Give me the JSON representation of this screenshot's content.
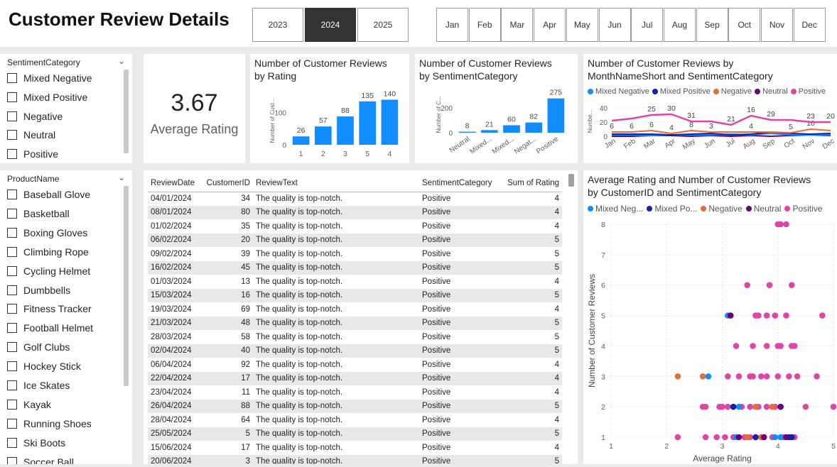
{
  "header": {
    "title": "Customer Review Details",
    "years": [
      {
        "label": "2023",
        "selected": false
      },
      {
        "label": "2024",
        "selected": true
      },
      {
        "label": "2025",
        "selected": false
      }
    ],
    "months": [
      "Jan",
      "Feb",
      "Mar",
      "Apr",
      "May",
      "Jun",
      "Jul",
      "Aug",
      "Sep",
      "Oct",
      "Nov",
      "Dec"
    ]
  },
  "sentiment_slicer": {
    "title": "SentimentCategory",
    "items": [
      "Mixed Negative",
      "Mixed Positive",
      "Negative",
      "Neutral",
      "Positive"
    ]
  },
  "product_slicer": {
    "title": "ProductName",
    "items": [
      "Baseball Glove",
      "Basketball",
      "Boxing Gloves",
      "Climbing Rope",
      "Cycling Helmet",
      "Dumbbells",
      "Fitness Tracker",
      "Football Helmet",
      "Golf Clubs",
      "Hockey Stick",
      "Ice Skates",
      "Kayak",
      "Running Shoes",
      "Ski Boots",
      "Soccer Ball"
    ]
  },
  "kpi": {
    "value": "3.67",
    "label": "Average Rating"
  },
  "colors": {
    "bar": "#118dff",
    "mixed_negative": "#118dff",
    "mixed_positive": "#12239e",
    "negative": "#e66c37",
    "neutral": "#6b007b",
    "positive": "#e044a7"
  },
  "chart_rating": {
    "title_line1": "Number of Customer Reviews",
    "title_line2": "by Rating",
    "ylabel": "Number of Cust...",
    "chart_data": {
      "type": "bar",
      "categories": [
        "1",
        "2",
        "3",
        "5",
        "4"
      ],
      "values": [
        26,
        57,
        88,
        135,
        140
      ],
      "ylim": [
        0,
        150
      ],
      "yticks": [
        "0",
        "100"
      ]
    }
  },
  "chart_sentiment": {
    "title_line1": "Number of Customer Reviews",
    "title_line2": "by SentimentCategory",
    "ylabel": "Number of C...",
    "chart_data": {
      "type": "bar",
      "categories": [
        "Neutral",
        "Mixed...",
        "Mixed...",
        "Negat...",
        "Positive"
      ],
      "values": [
        8,
        21,
        60,
        82,
        275
      ],
      "ylim": [
        0,
        290
      ],
      "yticks": [
        "0",
        "200"
      ]
    }
  },
  "chart_month": {
    "title_line1": "Number of Customer Reviews by",
    "title_line2": "MonthNameShort and SentimentCategory",
    "ylabel": "Numbe...",
    "legend": [
      "Mixed Negative",
      "Mixed Positive",
      "Negative",
      "Neutral",
      "Positive"
    ],
    "yticks": [
      "0",
      "20",
      "40"
    ],
    "chart_data": {
      "type": "line",
      "x": [
        "Jan",
        "Feb",
        "Mar",
        "Apr",
        "May",
        "Jun",
        "Jul",
        "Aug",
        "Sep",
        "Oct",
        "Nov",
        "Dec"
      ],
      "ylim": [
        0,
        42
      ],
      "series": [
        {
          "name": "Positive",
          "values": [
            22,
            25,
            30,
            31,
            21,
            21,
            16,
            29,
            23,
            23,
            20,
            20
          ],
          "labels": [
            "",
            "",
            "25",
            "30",
            "31",
            "",
            "21",
            "16",
            "29",
            "",
            "23",
            "20"
          ]
        },
        {
          "name": "Negative",
          "values": [
            6,
            6,
            8,
            4,
            8,
            6,
            6,
            6,
            6,
            5,
            10,
            8
          ],
          "labels": [
            "6",
            "6",
            "6",
            "4",
            "8",
            "3",
            "",
            "4",
            "",
            "5",
            "10",
            ""
          ]
        },
        {
          "name": "Mixed Positive",
          "values": [
            3,
            3,
            3,
            2,
            3,
            4,
            2,
            3,
            6,
            4,
            3,
            4
          ],
          "labels": []
        },
        {
          "name": "Mixed Negative",
          "values": [
            2,
            2,
            1,
            2,
            2,
            2,
            3,
            2,
            4,
            2,
            2,
            2
          ],
          "labels": []
        },
        {
          "name": "Neutral",
          "values": [
            0,
            0,
            1,
            1,
            0,
            1,
            0,
            1,
            0,
            1,
            2,
            1
          ],
          "labels": []
        }
      ]
    }
  },
  "chart_scatter": {
    "title_line1": "Average Rating and Number of Customer Reviews",
    "title_line2": "by CustomerID and SentimentCategory",
    "legend": [
      "Mixed Neg...",
      "Mixed Po...",
      "Negative",
      "Neutral",
      "Positive"
    ],
    "xlabel": "Average Rating",
    "ylabel": "Number of Customer Reviews",
    "xticks": [
      "1",
      "2",
      "3",
      "4",
      "5"
    ],
    "yticks": [
      "1",
      "2",
      "3",
      "4",
      "5",
      "6",
      "7",
      "8"
    ],
    "chart_data": {
      "type": "scatter",
      "xlim": [
        1,
        5
      ],
      "ylim": [
        1,
        8
      ],
      "series": [
        {
          "name": "Positive",
          "points": [
            [
              4.0,
              8
            ],
            [
              4.05,
              8
            ],
            [
              4.15,
              8
            ],
            [
              3.45,
              6
            ],
            [
              3.85,
              6
            ],
            [
              4.25,
              6
            ],
            [
              3.6,
              5
            ],
            [
              3.65,
              5
            ],
            [
              3.8,
              5
            ],
            [
              3.95,
              5
            ],
            [
              4.15,
              5
            ],
            [
              4.8,
              5
            ],
            [
              3.25,
              4
            ],
            [
              3.55,
              4
            ],
            [
              3.8,
              4
            ],
            [
              4.0,
              4
            ],
            [
              4.05,
              4
            ],
            [
              4.25,
              4
            ],
            [
              4.3,
              4
            ],
            [
              3.1,
              3
            ],
            [
              3.3,
              3
            ],
            [
              3.5,
              3
            ],
            [
              3.55,
              3
            ],
            [
              3.7,
              3
            ],
            [
              3.8,
              3
            ],
            [
              4.0,
              3
            ],
            [
              4.2,
              3
            ],
            [
              4.35,
              3
            ],
            [
              4.7,
              3
            ],
            [
              2.65,
              2
            ],
            [
              2.7,
              2
            ],
            [
              2.95,
              2
            ],
            [
              3.0,
              2
            ],
            [
              3.1,
              2
            ],
            [
              3.2,
              2
            ],
            [
              3.35,
              2
            ],
            [
              3.5,
              2
            ],
            [
              3.65,
              2
            ],
            [
              3.8,
              2
            ],
            [
              3.95,
              2
            ],
            [
              4.05,
              2
            ],
            [
              4.5,
              2
            ],
            [
              5.0,
              2
            ],
            [
              2.2,
              1
            ],
            [
              2.7,
              1
            ],
            [
              2.9,
              1
            ],
            [
              3.05,
              1
            ],
            [
              3.2,
              1
            ],
            [
              3.4,
              1
            ],
            [
              3.5,
              1
            ],
            [
              3.6,
              1
            ],
            [
              3.75,
              1
            ],
            [
              3.9,
              1
            ],
            [
              4.1,
              1
            ],
            [
              4.3,
              1
            ]
          ]
        },
        {
          "name": "Negative",
          "points": [
            [
              2.2,
              3
            ],
            [
              2.65,
              3
            ],
            [
              3.6,
              2
            ],
            [
              3.9,
              2
            ],
            [
              3.45,
              1
            ],
            [
              3.7,
              1
            ]
          ]
        },
        {
          "name": "Mixed Negative",
          "points": [
            [
              3.1,
              5
            ],
            [
              2.75,
              3
            ],
            [
              3.3,
              2
            ],
            [
              3.25,
              1
            ],
            [
              3.95,
              1
            ],
            [
              4.05,
              1
            ]
          ]
        },
        {
          "name": "Mixed Positive",
          "points": [
            [
              3.2,
              2
            ],
            [
              3.6,
              1
            ],
            [
              4.2,
              1
            ],
            [
              4.25,
              1
            ]
          ]
        },
        {
          "name": "Neutral",
          "points": [
            [
              3.15,
              5
            ],
            [
              4.05,
              2
            ],
            [
              3.3,
              1
            ],
            [
              3.75,
              1
            ],
            [
              4.15,
              1
            ]
          ]
        }
      ]
    }
  },
  "table": {
    "columns": [
      "ReviewDate",
      "CustomerID",
      "ReviewText",
      "SentimentCategory",
      "Sum of Rating"
    ],
    "rows": [
      [
        "04/01/2024",
        "34",
        "The quality is top-notch.",
        "Positive",
        "4"
      ],
      [
        "08/01/2024",
        "80",
        "The quality is top-notch.",
        "Positive",
        "4"
      ],
      [
        "01/02/2024",
        "35",
        "The quality is top-notch.",
        "Positive",
        "4"
      ],
      [
        "06/02/2024",
        "20",
        "The quality is top-notch.",
        "Positive",
        "5"
      ],
      [
        "09/02/2024",
        "39",
        "The quality is top-notch.",
        "Positive",
        "5"
      ],
      [
        "16/02/2024",
        "45",
        "The quality is top-notch.",
        "Positive",
        "5"
      ],
      [
        "01/03/2024",
        "13",
        "The quality is top-notch.",
        "Positive",
        "4"
      ],
      [
        "15/03/2024",
        "16",
        "The quality is top-notch.",
        "Positive",
        "5"
      ],
      [
        "19/03/2024",
        "69",
        "The quality is top-notch.",
        "Positive",
        "4"
      ],
      [
        "21/03/2024",
        "48",
        "The quality is top-notch.",
        "Positive",
        "5"
      ],
      [
        "28/03/2024",
        "58",
        "The quality is top-notch.",
        "Positive",
        "5"
      ],
      [
        "02/04/2024",
        "40",
        "The quality is top-notch.",
        "Positive",
        "5"
      ],
      [
        "06/04/2024",
        "92",
        "The quality is top-notch.",
        "Positive",
        "4"
      ],
      [
        "22/04/2024",
        "17",
        "The quality is top-notch.",
        "Positive",
        "4"
      ],
      [
        "23/04/2024",
        "11",
        "The quality is top-notch.",
        "Positive",
        "4"
      ],
      [
        "26/04/2024",
        "88",
        "The quality is top-notch.",
        "Positive",
        "5"
      ],
      [
        "28/04/2024",
        "64",
        "The quality is top-notch.",
        "Positive",
        "4"
      ],
      [
        "25/05/2024",
        "5",
        "The quality is top-notch.",
        "Positive",
        "5"
      ],
      [
        "15/06/2024",
        "17",
        "The quality is top-notch.",
        "Positive",
        "4"
      ],
      [
        "20/06/2024",
        "3",
        "The quality is top-notch.",
        "Positive",
        "5"
      ]
    ]
  }
}
